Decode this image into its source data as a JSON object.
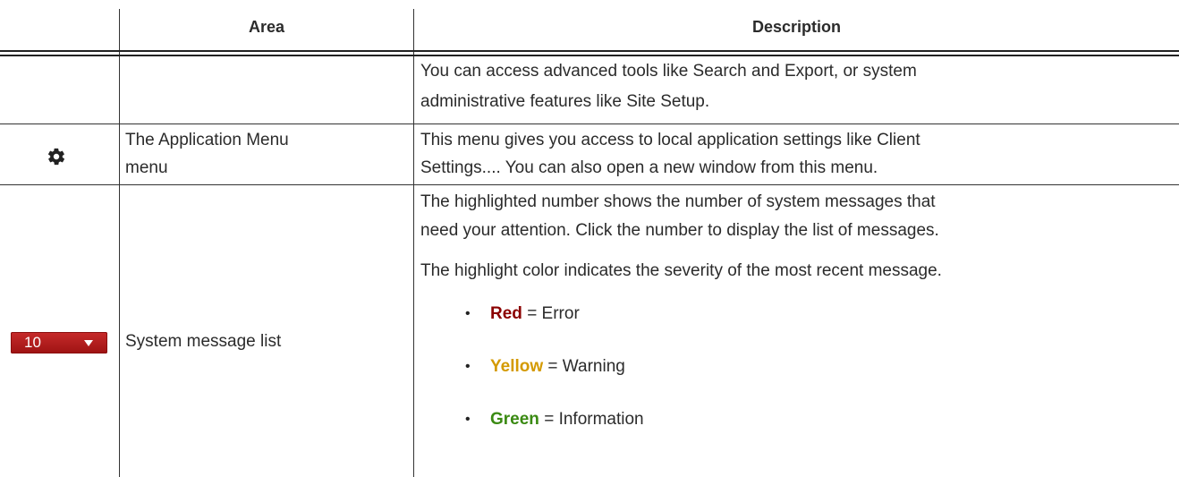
{
  "header": {
    "area": "Area",
    "description": "Description"
  },
  "rows": [
    {
      "icon": "",
      "area": "",
      "description_lines": [
        "You can access advanced tools like Search and Export, or system",
        "administrative features like Site Setup."
      ]
    },
    {
      "icon": "gear-icon",
      "area_lines": [
        "The Application Menu",
        "menu"
      ],
      "description_lines": [
        "This menu gives you access to local application settings like Client",
        "Settings.... You can also open a new window from this menu."
      ]
    },
    {
      "icon": "message-count-widget",
      "widget_count": "10",
      "area": "System message list",
      "description_lines": [
        "The highlighted number shows the number of system messages that",
        "need your attention. Click the number to display the list of messages."
      ],
      "severity_note": "The highlight color indicates the severity of the most recent message.",
      "severity_items": [
        {
          "label": "Red",
          "meaning": "= Error",
          "color": "#8b0000"
        },
        {
          "label": "Yellow",
          "meaning": "= Warning",
          "color": "#d49a00"
        },
        {
          "label": "Green",
          "meaning": "= Information",
          "color": "#3a8a12"
        }
      ]
    }
  ],
  "colors": {
    "widget_background": "#b31d1d",
    "rule": "#333333"
  }
}
